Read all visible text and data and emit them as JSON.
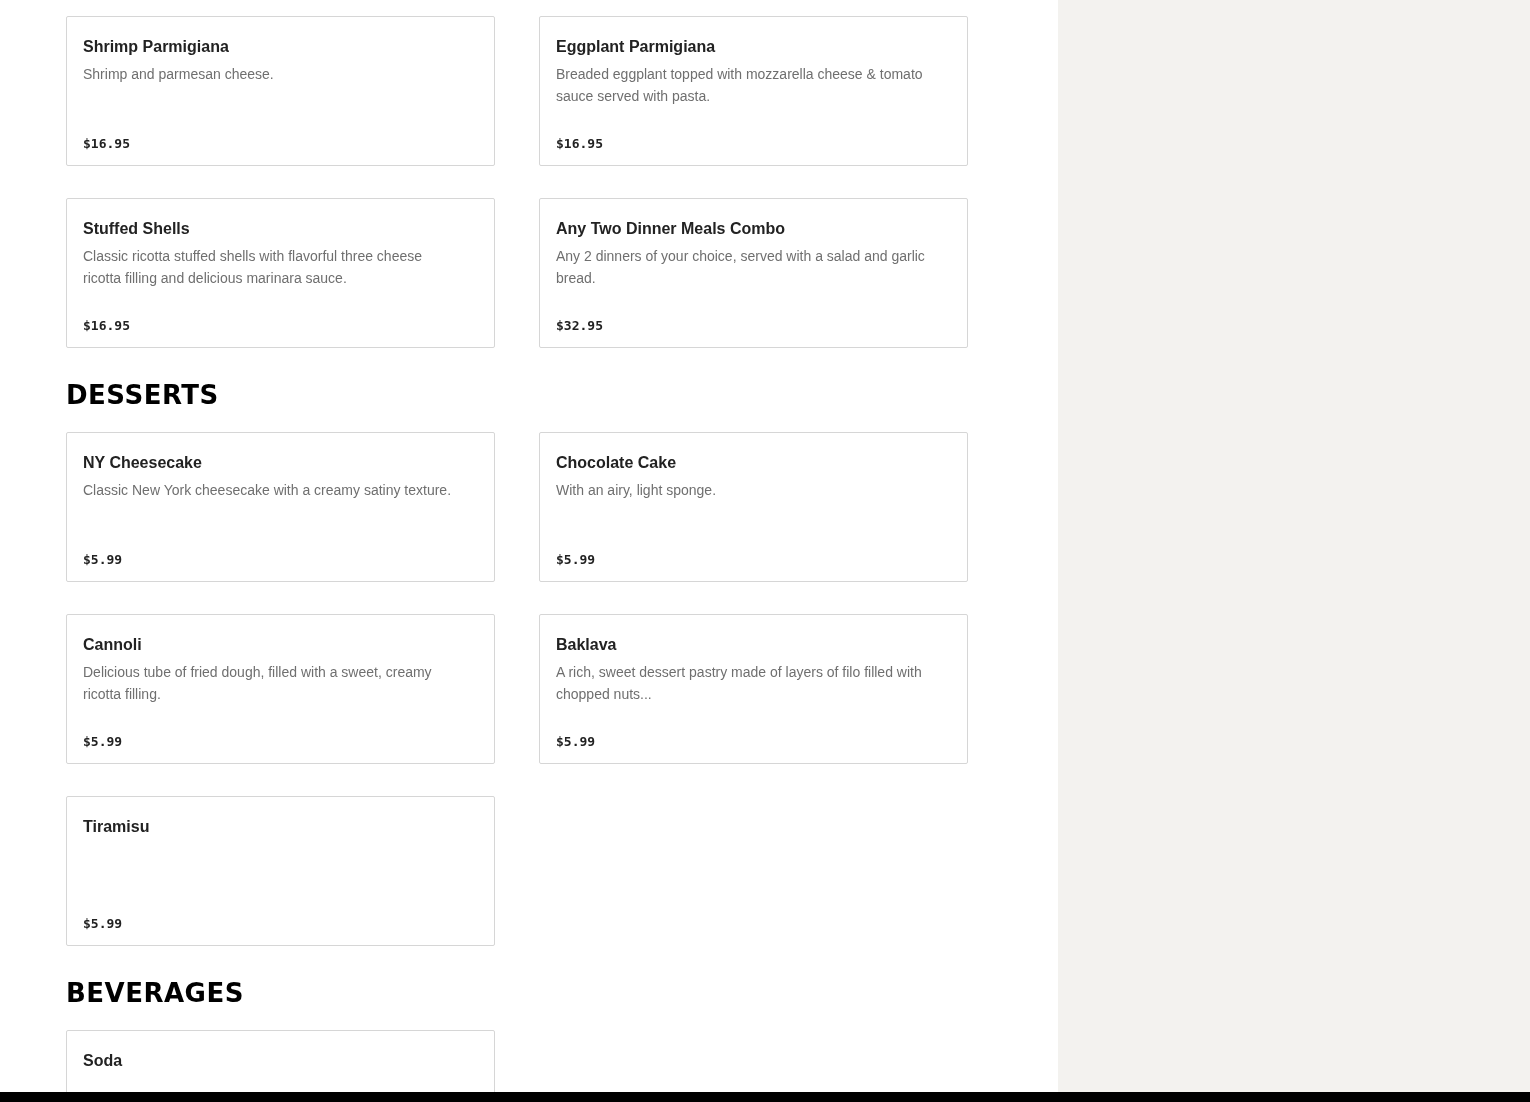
{
  "sections": [
    {
      "items": [
        {
          "name": "Shrimp Parmigiana",
          "description": "Shrimp and parmesan cheese.",
          "price": "$16.95"
        },
        {
          "name": "Eggplant Parmigiana",
          "description": "Breaded eggplant topped with mozzarella cheese & tomato sauce served with pasta.",
          "price": "$16.95"
        },
        {
          "name": "Stuffed Shells",
          "description": "Classic ricotta stuffed shells with flavorful three cheese ricotta filling and delicious marinara sauce.",
          "price": "$16.95"
        },
        {
          "name": "Any Two Dinner Meals Combo",
          "description": "Any 2 dinners of your choice, served with a salad and garlic bread.",
          "price": "$32.95"
        }
      ]
    },
    {
      "heading": "DESSERTS",
      "items": [
        {
          "name": "NY Cheesecake",
          "description": "Classic New York cheesecake with a creamy satiny texture.",
          "price": "$5.99"
        },
        {
          "name": "Chocolate Cake",
          "description": "With an airy, light sponge.",
          "price": "$5.99"
        },
        {
          "name": "Cannoli",
          "description": "Delicious tube of fried dough, filled with a sweet, creamy ricotta filling.",
          "price": "$5.99"
        },
        {
          "name": "Baklava",
          "description": "A rich, sweet dessert pastry made of layers of filo filled with chopped nuts...",
          "price": "$5.99"
        },
        {
          "name": "Tiramisu",
          "price": "$5.99"
        }
      ]
    },
    {
      "heading": "BEVERAGES",
      "items": [
        {
          "name": "Soda"
        }
      ]
    }
  ]
}
